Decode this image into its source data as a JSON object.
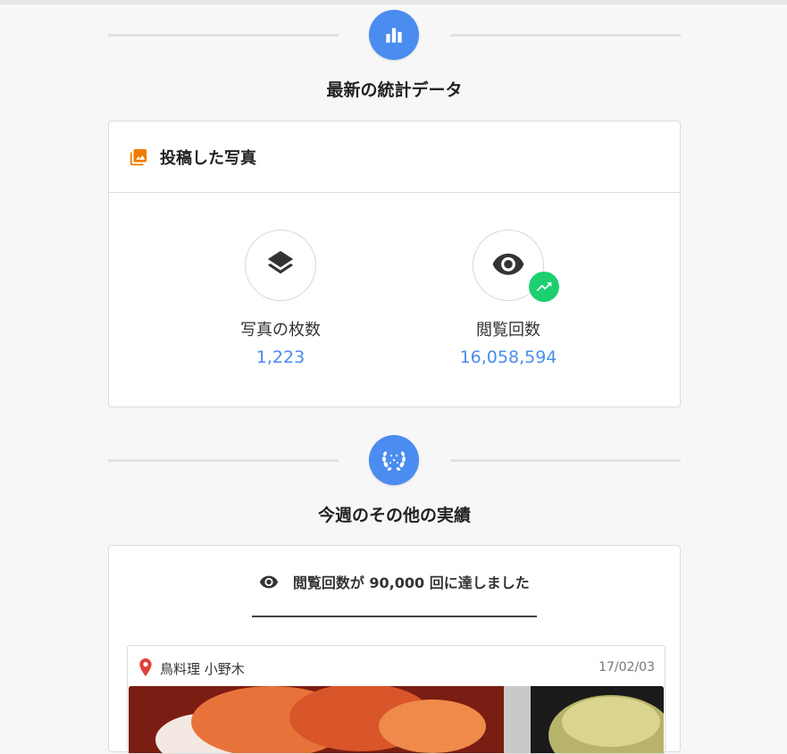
{
  "stats_section": {
    "title": "最新の統計データ",
    "icon": "bar-chart-icon",
    "accent_color": "#4a8cf0"
  },
  "photos_card": {
    "title": "投稿した写真",
    "icon": "photo-library-icon",
    "icon_color": "#f07c00",
    "stats": [
      {
        "icon": "layers-icon",
        "label": "写真の枚数",
        "value": "1,223"
      },
      {
        "icon": "eye-icon",
        "label": "閲覧回数",
        "value": "16,058,594",
        "badge_icon": "trending-up-icon",
        "badge_color": "#1dcf70"
      }
    ]
  },
  "achievements_section": {
    "title": "今週のその他の実績",
    "icon": "laurel-wreath-icon"
  },
  "achievement_card": {
    "heading": "閲覧回数が 90,000 回に達しました",
    "heading_icon": "eye-icon",
    "item": {
      "location_icon": "map-pin-icon",
      "place": "鳥料理 小野木",
      "date": "17/02/03"
    }
  }
}
